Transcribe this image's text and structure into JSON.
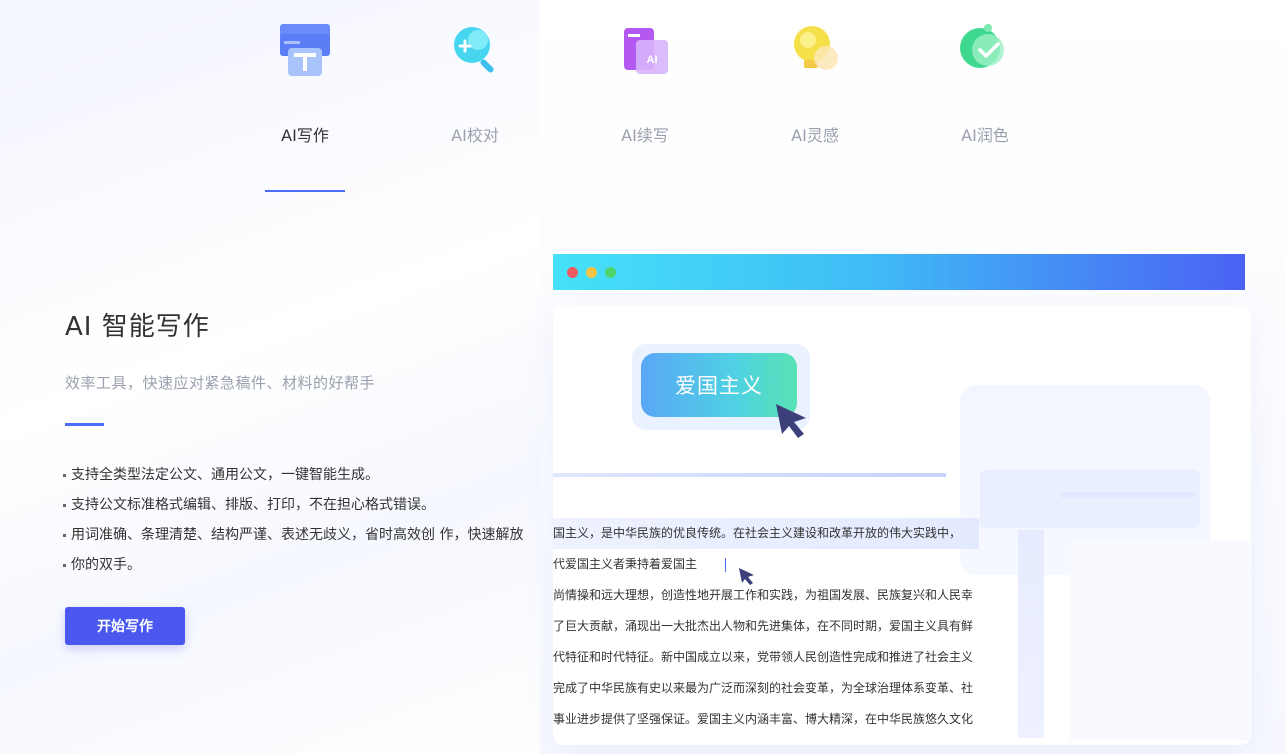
{
  "tabs": [
    {
      "label": "AI写作",
      "icon": "ai-write-icon",
      "active": true
    },
    {
      "label": "AI校对",
      "icon": "ai-proofread-icon",
      "active": false
    },
    {
      "label": "AI续写",
      "icon": "ai-continue-icon",
      "active": false
    },
    {
      "label": "AI灵感",
      "icon": "ai-inspiration-icon",
      "active": false
    },
    {
      "label": "AI润色",
      "icon": "ai-polish-icon",
      "active": false
    }
  ],
  "hero": {
    "title": "AI 智能写作",
    "subtitle": "效率工具，快速应对紧急稿件、材料的好帮手",
    "features": [
      "支持全类型法定公文、通用公文，一键智能生成。",
      "支持公文标准格式编辑、排版、打印，不在担心格式错误。",
      "用词准确、条理清楚、结构严谨、表述无歧义，省时高效创 作，快速解放",
      "你的双手。"
    ],
    "start_button": "开始写作"
  },
  "mockup": {
    "keyword_bubble": "爱国主义",
    "lines": [
      "国主义，是中华民族的优良传统。在社会主义建设和改革开放的伟大实践中，",
      "代爱国主义者秉持着爱国主",
      "尚情操和远大理想，创造性地开展工作和实践，为祖国发展、民族复兴和人民幸",
      "了巨大贡献，涌现出一大批杰出人物和先进集体，在不同时期，爱国主义具有鲜",
      "代特征和时代特征。新中国成立以来，党带领人民创造性完成和推进了社会主义",
      "完成了中华民族有史以来最为广泛而深刻的社会变革，为全球治理体系变革、社",
      "事业进步提供了坚强保证。爱国主义内涵丰富、博大精深，在中华民族悠久文化"
    ]
  },
  "colors": {
    "accent": "#4a58f0",
    "underline": "#4a6cf7",
    "window_red": "#ef5b62",
    "window_yellow": "#f6c344",
    "window_green": "#4ed46b"
  }
}
